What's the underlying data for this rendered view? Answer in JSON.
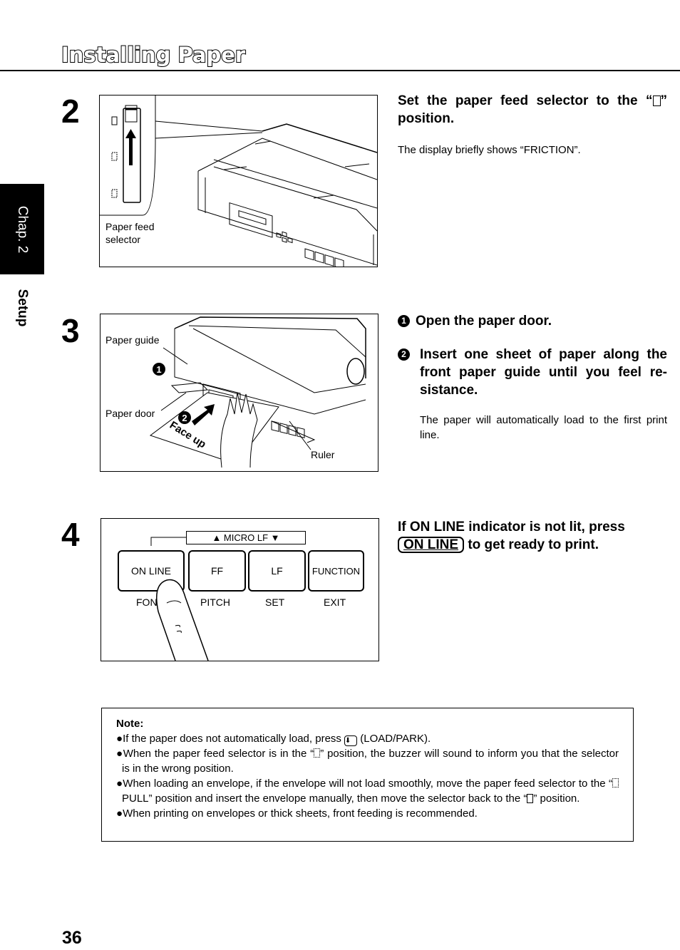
{
  "page": {
    "title": "Installing Paper",
    "page_number": "36",
    "chapter_tab": "Chap. 2",
    "section_label": "Setup"
  },
  "steps": [
    {
      "number": "2",
      "heading_pre": "Set the paper feed selector to the “",
      "heading_post": "” position.",
      "body": "The display briefly shows “FRICTION”.",
      "figure": {
        "labels": [
          "Paper feed\nselector"
        ],
        "selector_icons": [
          "friction-icon",
          "pull-tractor-icon",
          "push-tractor-icon"
        ]
      }
    },
    {
      "number": "3",
      "substeps": [
        {
          "marker": "1",
          "text": "Open the paper door."
        },
        {
          "marker": "2",
          "text": "Insert one sheet of paper along the front paper guide until you feel re-sistance."
        }
      ],
      "body": "The paper will automatically load to the first print line.",
      "figure": {
        "labels": [
          "Paper guide",
          "Paper door",
          "Ruler"
        ],
        "paper_text": "Face up",
        "callouts": [
          "1",
          "2"
        ]
      }
    },
    {
      "number": "4",
      "heading_pre": "If ON LINE indicator is not lit, press",
      "key_label": "ON LINE",
      "heading_post": " to get ready to print.",
      "figure": {
        "micro_lf_label": "▲ MICRO LF ▼",
        "keys": [
          {
            "label": "ON LINE",
            "sub": "FONT"
          },
          {
            "label": "FF",
            "sub": "PITCH"
          },
          {
            "label": "LF",
            "sub": "SET"
          },
          {
            "label": "FUNCTION",
            "sub": "EXIT"
          }
        ]
      }
    }
  ],
  "note": {
    "title": "Note:",
    "items": [
      {
        "pre": "If the paper does not automatically load, press ",
        "key": "⬇",
        "post": " (LOAD/PARK)."
      },
      {
        "pre": "When the paper feed selector is in the “",
        "post": "” position, the buzzer will sound to inform you that the selector is in the wrong position."
      },
      {
        "pre": "When loading an envelope, if the envelope will not load smoothly, move the paper feed selector to the “",
        "mid": " PULL” position and insert the envelope manually, then move the selector back to the “",
        "post": "” position."
      },
      {
        "pre": "When printing on envelopes or thick sheets, front feeding is recommended."
      }
    ]
  }
}
